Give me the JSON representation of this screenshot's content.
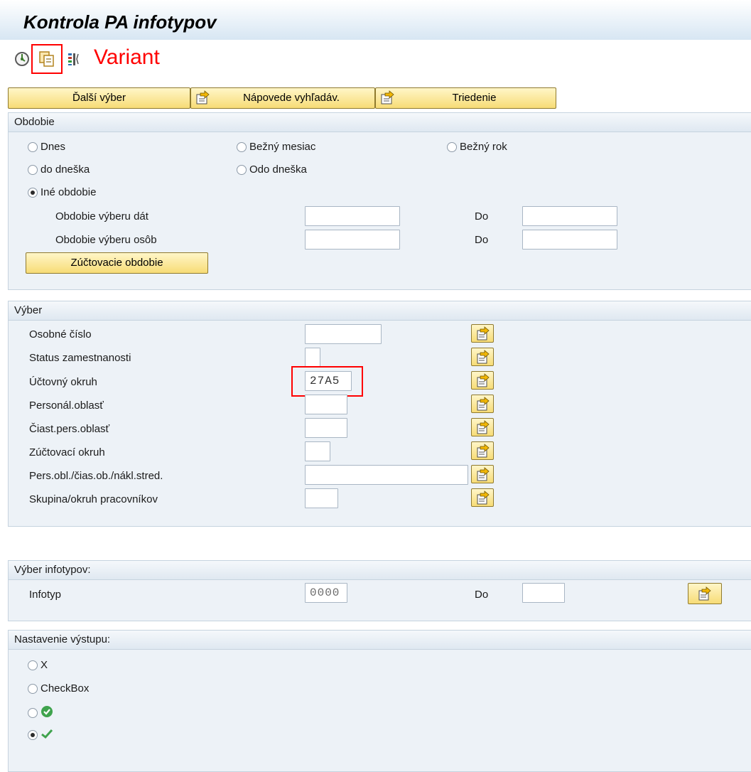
{
  "title": "Kontrola PA infotypov",
  "toolbar": {
    "variant_label": "Variant",
    "icons": [
      "execute-icon",
      "get-variant-icon",
      "selection-options-icon"
    ]
  },
  "buttons": {
    "more_selection": "Ďalší výber",
    "search_help": "Nápovede vyhľadáv.",
    "sort": "Triedenie"
  },
  "period": {
    "header": "Obdobie",
    "options": {
      "today": "Dnes",
      "current_month": "Bežný mesiac",
      "current_year": "Bežný rok",
      "up_to_today": "do dneška",
      "from_today": "Odo dneška",
      "other_period": "Iné obdobie"
    },
    "selected": "other_period",
    "data_selection_label": "Obdobie výberu dát",
    "person_selection_label": "Obdobie výberu osôb",
    "to_label": "Do",
    "data_selection_from": "",
    "data_selection_to": "",
    "person_selection_from": "",
    "person_selection_to": "",
    "payroll_period_button": "Zúčtovacie obdobie"
  },
  "selection": {
    "header": "Výber",
    "fields": [
      {
        "label": "Osobné číslo",
        "value": ""
      },
      {
        "label": "Status zamestnanosti",
        "value": ""
      },
      {
        "label": "Účtovný okruh",
        "value": "27A5"
      },
      {
        "label": "Personál.oblasť",
        "value": ""
      },
      {
        "label": "Čiast.pers.oblasť",
        "value": ""
      },
      {
        "label": "Zúčtovací okruh",
        "value": ""
      },
      {
        "label": "Pers.obl./čias.ob./nákl.stred.",
        "value": ""
      },
      {
        "label": "Skupina/okruh pracovníkov",
        "value": ""
      }
    ]
  },
  "infotype_selection": {
    "header": "Výber infotypov:",
    "label": "Infotyp",
    "from_value": "0000",
    "to_label": "Do",
    "to_value": ""
  },
  "output_settings": {
    "header": "Nastavenie výstupu:",
    "options": [
      "X",
      "CheckBox",
      "green-check-circle-icon",
      "green-checkmark-icon"
    ],
    "selected_index": 3
  },
  "colors": {
    "title_gradient_end": "#d7e6f3",
    "button_yellow": "#f7dc76",
    "group_bg": "#edf2f7",
    "highlight_red": "#ff0000"
  }
}
